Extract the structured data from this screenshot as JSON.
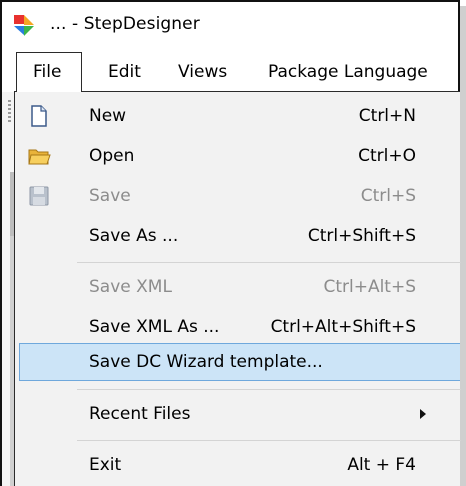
{
  "window": {
    "title": "... - StepDesigner"
  },
  "menubar": {
    "items": [
      {
        "label": "File"
      },
      {
        "label": "Edit"
      },
      {
        "label": "Views"
      },
      {
        "label": "Package Language"
      }
    ]
  },
  "file_menu": {
    "items": [
      {
        "label": "New",
        "shortcut": "Ctrl+N",
        "icon": "new-document-icon",
        "enabled": true
      },
      {
        "label": "Open",
        "shortcut": "Ctrl+O",
        "icon": "open-folder-icon",
        "enabled": true
      },
      {
        "label": "Save",
        "shortcut": "Ctrl+S",
        "icon": "save-disk-icon",
        "enabled": false
      },
      {
        "label": "Save As ...",
        "shortcut": "Ctrl+Shift+S",
        "enabled": true
      },
      {
        "label": "Save XML",
        "shortcut": "Ctrl+Alt+S",
        "enabled": false
      },
      {
        "label": "Save XML As ...",
        "shortcut": "Ctrl+Alt+Shift+S",
        "enabled": true
      },
      {
        "label": "Save DC Wizard template...",
        "shortcut": "",
        "enabled": true,
        "highlighted": true
      },
      {
        "label": "Recent Files",
        "shortcut": "",
        "enabled": true,
        "submenu": true
      },
      {
        "label": "Exit",
        "shortcut": "Alt + F4",
        "enabled": true
      }
    ]
  },
  "colors": {
    "highlight_bg": "#cce4f7",
    "highlight_border": "#6fa8dc",
    "disabled_text": "#8c8c8c",
    "menu_bg": "#f2f2f2"
  }
}
